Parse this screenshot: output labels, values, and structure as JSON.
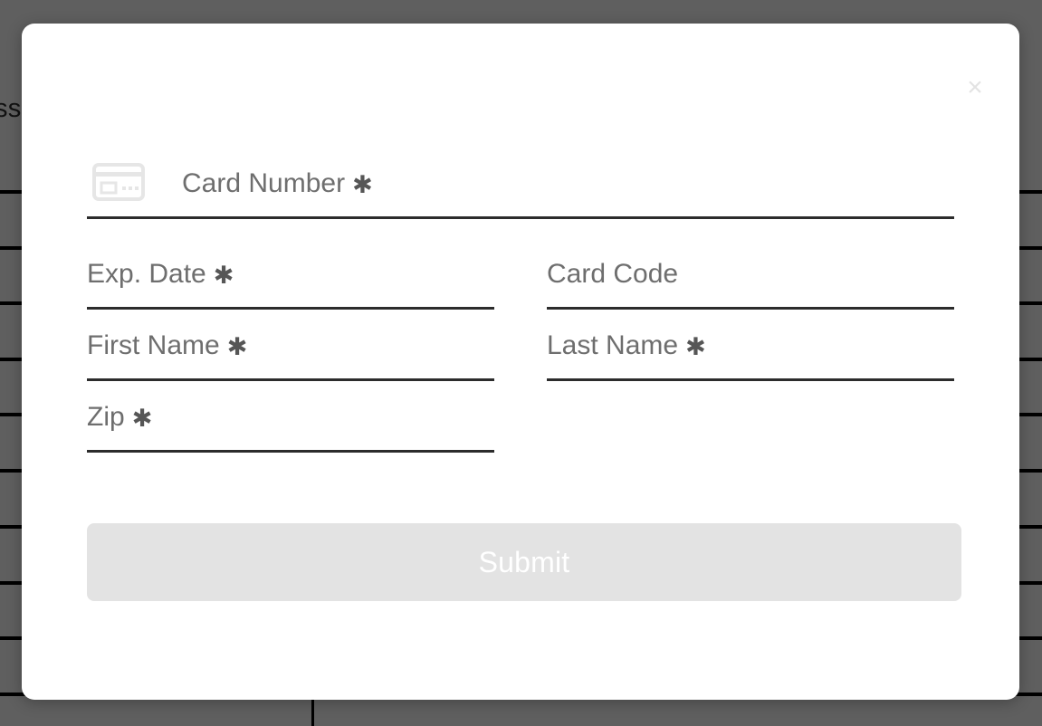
{
  "background": {
    "partial_text": "ss",
    "description": "dimmed page with table rows behind modal"
  },
  "modal": {
    "close_label": "×",
    "card_icon": "credit-card-icon",
    "required_marker": "✱",
    "fields": [
      {
        "id": "card-number",
        "label": "Card Number",
        "required": true,
        "value": "",
        "placeholder": "",
        "icon": "credit-card-icon",
        "width": "wide"
      },
      {
        "id": "exp-date",
        "label": "Exp. Date",
        "required": true,
        "value": "",
        "placeholder": "",
        "width": "half"
      },
      {
        "id": "card-code",
        "label": "Card Code",
        "required": false,
        "value": "",
        "placeholder": "",
        "width": "half"
      },
      {
        "id": "first-name",
        "label": "First Name",
        "required": true,
        "value": "",
        "placeholder": "",
        "width": "half"
      },
      {
        "id": "last-name",
        "label": "Last Name",
        "required": true,
        "value": "",
        "placeholder": "",
        "width": "half"
      },
      {
        "id": "zip",
        "label": "Zip",
        "required": true,
        "value": "",
        "placeholder": "",
        "width": "half"
      }
    ],
    "submit_label": "Submit"
  },
  "colors": {
    "backdrop": "#5f5f5f",
    "modal_bg": "#ffffff",
    "field_underline": "#2c2c2c",
    "label_text": "#6e6e6e",
    "required_star": "#565656",
    "submit_bg": "#e3e3e3",
    "submit_text": "#ffffff",
    "close_icon": "#e3e3e3",
    "card_icon": "#e6e6e6"
  }
}
